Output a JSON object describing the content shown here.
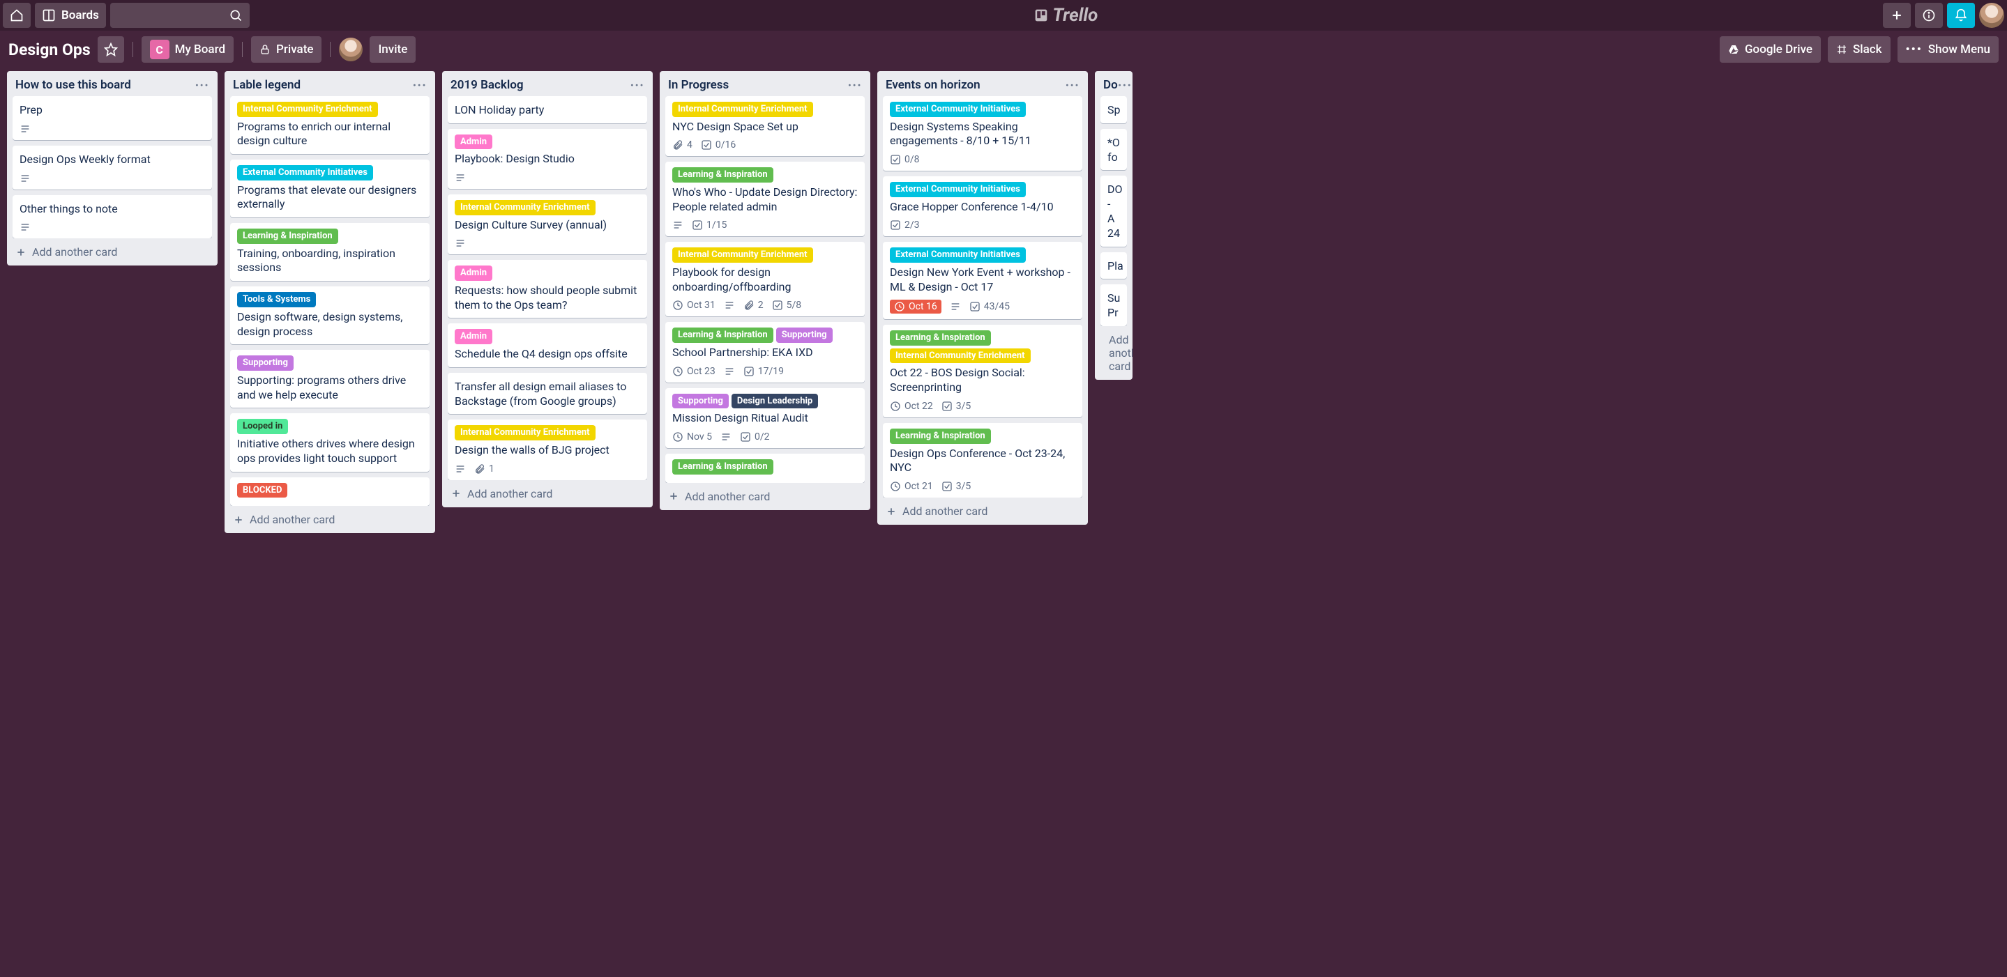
{
  "topbar": {
    "boards_label": "Boards",
    "logo_text": "Trello"
  },
  "board_header": {
    "title": "Design Ops",
    "team_label": "My Board",
    "team_chip": "C",
    "visibility": "Private",
    "invite": "Invite",
    "google_drive": "Google Drive",
    "slack": "Slack",
    "show_menu": "Show Menu"
  },
  "label_colors": {
    "Internal Community Enrichment": "c-yellow",
    "External Community Initiatives": "c-sky",
    "Learning & Inspiration": "c-green",
    "Tools & Systems": "c-blue",
    "Supporting": "c-purple",
    "Looped in": "c-lime",
    "BLOCKED": "c-red",
    "Admin": "c-pink",
    "Design Leadership": "c-dark"
  },
  "add_card_label": "Add another card",
  "lists": [
    {
      "name": "How to use this board",
      "cards": [
        {
          "title": "Prep",
          "badges": {
            "desc": true
          }
        },
        {
          "title": "Design Ops Weekly format",
          "badges": {
            "desc": true
          }
        },
        {
          "title": "Other things to note",
          "badges": {
            "desc": true
          }
        }
      ]
    },
    {
      "name": "Lable legend",
      "cards": [
        {
          "labels": [
            "Internal Community Enrichment"
          ],
          "title": "Programs to enrich our internal design culture"
        },
        {
          "labels": [
            "External Community Initiatives"
          ],
          "title": "Programs that elevate our designers externally"
        },
        {
          "labels": [
            "Learning & Inspiration"
          ],
          "title": "Training, onboarding, inspiration sessions"
        },
        {
          "labels": [
            "Tools & Systems"
          ],
          "title": "Design software, design systems, design process"
        },
        {
          "labels": [
            "Supporting"
          ],
          "title": "Supporting: programs others drive and we help execute"
        },
        {
          "labels": [
            "Looped in"
          ],
          "title": "Initiative others drives where design ops provides light touch support"
        },
        {
          "labels": [
            "BLOCKED"
          ],
          "title": ""
        }
      ]
    },
    {
      "name": "2019 Backlog",
      "cards": [
        {
          "title": "LON Holiday party"
        },
        {
          "labels": [
            "Admin"
          ],
          "title": "Playbook: Design Studio",
          "badges": {
            "desc": true
          }
        },
        {
          "labels": [
            "Internal Community Enrichment"
          ],
          "title": "Design Culture Survey (annual)",
          "badges": {
            "desc": true
          }
        },
        {
          "labels": [
            "Admin"
          ],
          "title": "Requests: how should people submit them to the Ops team?"
        },
        {
          "labels": [
            "Admin"
          ],
          "title": "Schedule the Q4 design ops offsite"
        },
        {
          "title": "Transfer all design email aliases to Backstage (from Google groups)"
        },
        {
          "labels": [
            "Internal Community Enrichment"
          ],
          "title": "Design the walls of BJG project",
          "badges": {
            "desc": true,
            "attachments": 1
          }
        }
      ]
    },
    {
      "name": "In Progress",
      "cards": [
        {
          "labels": [
            "Internal Community Enrichment"
          ],
          "title": "NYC Design Space Set up",
          "badges": {
            "attachments": 4,
            "check": "0/16"
          }
        },
        {
          "labels": [
            "Learning & Inspiration"
          ],
          "title": "Who's Who - Update Design Directory: People related admin",
          "badges": {
            "desc": true,
            "check": "1/15"
          }
        },
        {
          "labels": [
            "Internal Community Enrichment"
          ],
          "title": "Playbook for design onboarding/offboarding",
          "badges": {
            "date": "Oct 31",
            "desc": true,
            "attachments": 2,
            "check": "5/8"
          }
        },
        {
          "labels": [
            "Learning & Inspiration",
            "Supporting"
          ],
          "title": "School Partnership: EKA IXD",
          "badges": {
            "date": "Oct 23",
            "desc": true,
            "check": "17/19"
          }
        },
        {
          "labels": [
            "Supporting",
            "Design Leadership"
          ],
          "title": "Mission Design Ritual Audit",
          "badges": {
            "date": "Nov 5",
            "desc": true,
            "check": "0/2"
          }
        },
        {
          "labels": [
            "Learning & Inspiration"
          ],
          "title": ""
        }
      ]
    },
    {
      "name": "Events on horizon",
      "cards": [
        {
          "labels": [
            "External Community Initiatives"
          ],
          "title": "Design Systems Speaking engagements - 8/10 + 15/11",
          "badges": {
            "check": "0/8"
          }
        },
        {
          "labels": [
            "External Community Initiatives"
          ],
          "title": "Grace Hopper Conference 1-4/10",
          "badges": {
            "check": "2/3"
          }
        },
        {
          "labels": [
            "External Community Initiatives"
          ],
          "title": "Design New York Event + workshop - ML & Design - Oct 17",
          "badges": {
            "date": "Oct 16",
            "date_soon": true,
            "desc": true,
            "check": "43/45"
          }
        },
        {
          "labels": [
            "Learning & Inspiration",
            "Internal Community Enrichment"
          ],
          "title": "Oct 22 - BOS Design Social: Screenprinting",
          "badges": {
            "date": "Oct 22",
            "check": "3/5"
          }
        },
        {
          "labels": [
            "Learning & Inspiration"
          ],
          "title": "Design Ops Conference - Oct 23-24, NYC",
          "badges": {
            "date": "Oct 21",
            "check": "3/5"
          }
        }
      ]
    },
    {
      "name": "Do",
      "partial": true,
      "cards": [
        {
          "title": "Sp"
        },
        {
          "title": "*O\nfo"
        },
        {
          "title": "DO\n- A\n24"
        },
        {
          "title": "Pla"
        },
        {
          "title": "Su\nPr"
        }
      ]
    }
  ]
}
